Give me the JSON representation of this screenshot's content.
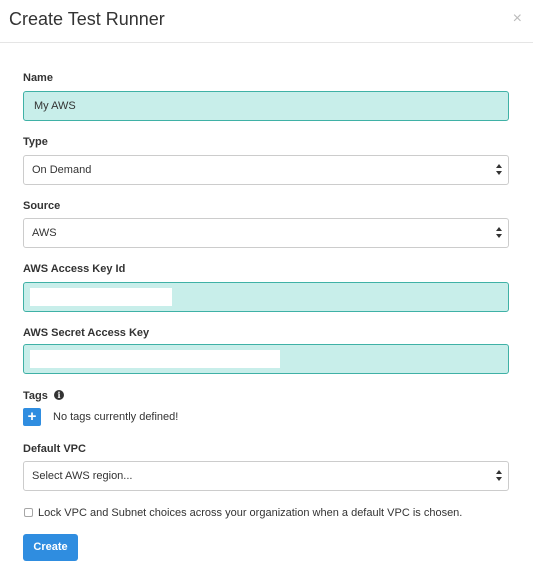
{
  "modal": {
    "title": "Create Test Runner",
    "close_symbol": "×"
  },
  "form": {
    "name_label": "Name",
    "name_value": "My AWS",
    "type_label": "Type",
    "type_value": "On Demand",
    "source_label": "Source",
    "source_value": "AWS",
    "access_key_label": "AWS Access Key Id",
    "access_key_value": "",
    "secret_key_label": "AWS Secret Access Key",
    "secret_key_value": "",
    "tags_label": "Tags",
    "tags_info_symbol": "i",
    "add_tag_symbol": "+",
    "tags_empty_text": "No tags currently defined!",
    "vpc_label": "Default VPC",
    "vpc_value": "Select AWS region...",
    "lock_checked": false,
    "lock_label": "Lock VPC and Subnet choices across your organization when a default VPC is chosen.",
    "submit_label": "Create"
  },
  "colors": {
    "accent": "#2f8de0",
    "field_fill": "#c8eeea",
    "field_border": "#3fb1a6"
  },
  "icons": {
    "close": "close-icon",
    "info": "info-icon",
    "add": "plus-icon",
    "select_caret": "sort-caret-icon"
  }
}
